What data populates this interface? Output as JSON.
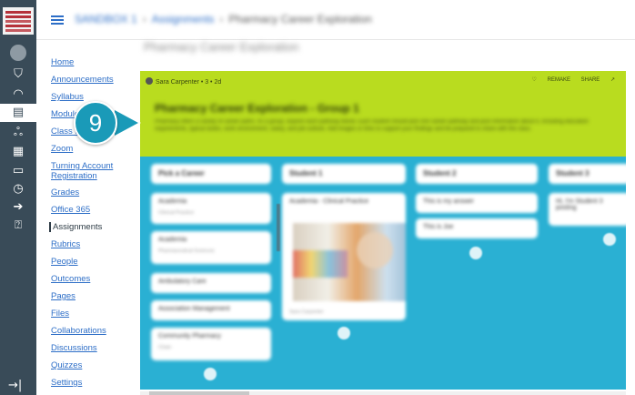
{
  "global_nav": {
    "icons": [
      "account-avatar-icon",
      "admin-shield-icon",
      "dashboard-gauge-icon",
      "courses-book-icon",
      "groups-icon",
      "calendar-icon",
      "inbox-icon",
      "history-clock-icon",
      "commons-arrow-icon",
      "help-question-icon"
    ],
    "collapse_glyph": "→|"
  },
  "header": {
    "breadcrumb": [
      "SANDBOX 1",
      "Assignments",
      "Pharmacy Career Exploration"
    ]
  },
  "page_title": "Pharmacy Career Exploration",
  "course_nav": {
    "items": [
      {
        "label": "Home"
      },
      {
        "label": "Announcements"
      },
      {
        "label": "Syllabus"
      },
      {
        "label": "Modules"
      },
      {
        "label": "Class N"
      },
      {
        "label": "Zoom"
      },
      {
        "label": "Turning Account Registration"
      },
      {
        "label": "Grades"
      },
      {
        "label": "Office 365"
      },
      {
        "label": "Assignments"
      },
      {
        "label": "Rubrics"
      },
      {
        "label": "People"
      },
      {
        "label": "Outcomes"
      },
      {
        "label": "Pages"
      },
      {
        "label": "Files"
      },
      {
        "label": "Collaborations"
      },
      {
        "label": "Discussions"
      },
      {
        "label": "Quizzes"
      },
      {
        "label": "Settings"
      }
    ],
    "hidden_glyph": "⊘"
  },
  "board": {
    "author": "Sara Carpenter",
    "meta": "• 3 • 2d",
    "actions": [
      "♡",
      "REMAKE",
      "SHARE",
      "↗"
    ],
    "title": "Pharmacy Career Exploration - Group 1",
    "description": "Pharmacy offers a variety of career paths. As a group, explore each pathway below. Each student should pick one career pathway and post information about it, including education requirements, typical duties, work environment, salary, and job outlook. Add images or links to support your findings and be prepared to share with the class.",
    "columns": [
      "Pick a Career",
      "Student 1",
      "Student 2",
      "Student 3"
    ],
    "cards": {
      "col1": [
        {
          "title": "Academia",
          "sub": "Clinical Practice"
        },
        {
          "title": "Academia",
          "sub": "Pharmaceutical Sciences"
        },
        {
          "title": "Ambulatory Care",
          "sub": ""
        },
        {
          "title": "Association Management",
          "sub": ""
        },
        {
          "title": "Community Pharmacy",
          "sub": "Chain"
        }
      ],
      "col2": [
        {
          "title": "Academia - Clinical Practice",
          "caption": "Sara Carpenter"
        }
      ],
      "col3": [
        {
          "title": "This is my answer"
        },
        {
          "title": "This is Joe"
        }
      ],
      "col4": [
        {
          "title": "Hi, I'm Student 3 posting"
        }
      ]
    }
  },
  "callout": {
    "number": "9",
    "color": "#1a9ab8"
  },
  "colors": {
    "board_bg": "#2ab0d3",
    "banner": "#b9dc1f",
    "global_nav": "#394B58",
    "link": "#2d6ec7"
  }
}
